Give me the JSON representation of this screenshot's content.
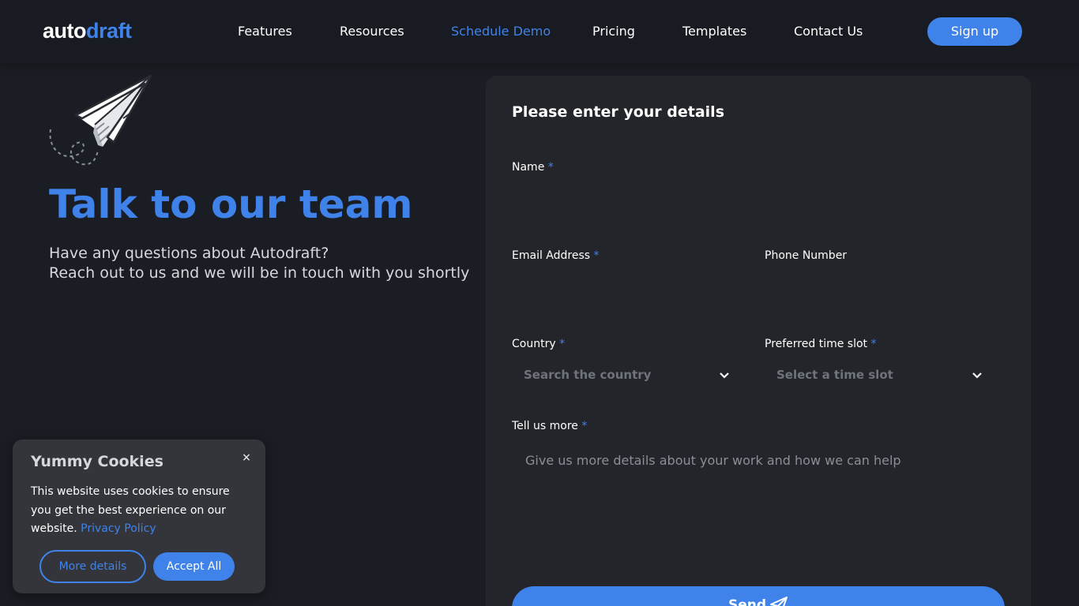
{
  "nav": {
    "logo_part1": "auto",
    "logo_part2": "draft",
    "links": [
      {
        "label": "Features"
      },
      {
        "label": "Resources"
      },
      {
        "label": "Schedule Demo"
      },
      {
        "label": "Pricing"
      },
      {
        "label": "Templates"
      },
      {
        "label": "Contact Us"
      }
    ],
    "active": "Schedule Demo",
    "signup_label": "Sign up"
  },
  "hero": {
    "title": "Talk to our team",
    "subtitle_line1": "Have any questions about Autodraft?",
    "subtitle_line2": "Reach out to us and we will be in touch with you shortly",
    "illustration_icon": "paper-plane-icon"
  },
  "form": {
    "title": "Please enter your details",
    "required_mark": "*",
    "name_label": "Name",
    "name_value": "",
    "email_label": "Email Address",
    "email_value": "",
    "phone_label": "Phone Number",
    "phone_value": "",
    "country_label": "Country",
    "country_placeholder": "Search the country",
    "timeslot_label": "Preferred time slot",
    "timeslot_placeholder": "Select a time slot",
    "more_label": "Tell us more",
    "more_placeholder": "Give us more details about your work and how we can help",
    "send_label": "Send",
    "send_icon": "send-icon"
  },
  "cookies": {
    "title": "Yummy Cookies",
    "close_glyph": "×",
    "text": "This website uses cookies to ensure you get the best experience on our website.",
    "privacy_link": "Privacy Policy",
    "more_details_label": "More details",
    "accept_label": "Accept All"
  },
  "colors": {
    "accent": "#3f83ea",
    "background": "#1b1d24",
    "card": "#23252a",
    "cookie_bg": "#33353a"
  }
}
